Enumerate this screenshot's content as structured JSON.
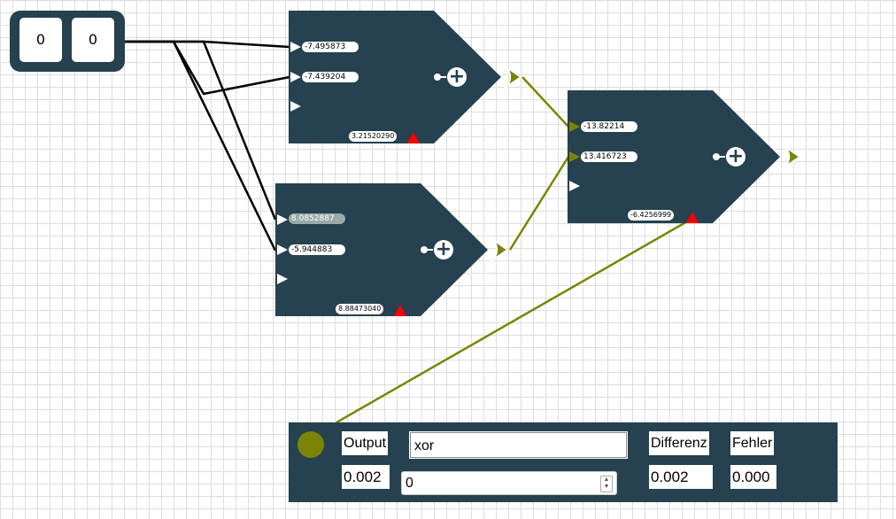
{
  "inputs": [
    "0",
    "0"
  ],
  "neurons": [
    {
      "weights": [
        "-7.495873",
        "-7.439204"
      ],
      "bias": "3.21520290"
    },
    {
      "weights": [
        "8.0852887",
        "-5.944883"
      ],
      "bias": "8.88473040"
    },
    {
      "weights": [
        "-13.82214",
        "13.416723"
      ],
      "bias": "-6.4256999"
    }
  ],
  "plus_symbol": "+",
  "output_panel": {
    "output_label": "Output",
    "output_value": "0.002",
    "name_value": "xor",
    "target_value": "0",
    "differenz_label": "Differenz",
    "differenz_value": "0.002",
    "fehler_label": "Fehler",
    "fehler_value": "0.000"
  },
  "colors": {
    "node": "#26414f",
    "active": "#7b8405",
    "bias_marker": "#ff0000",
    "connection_input": "#000000"
  }
}
